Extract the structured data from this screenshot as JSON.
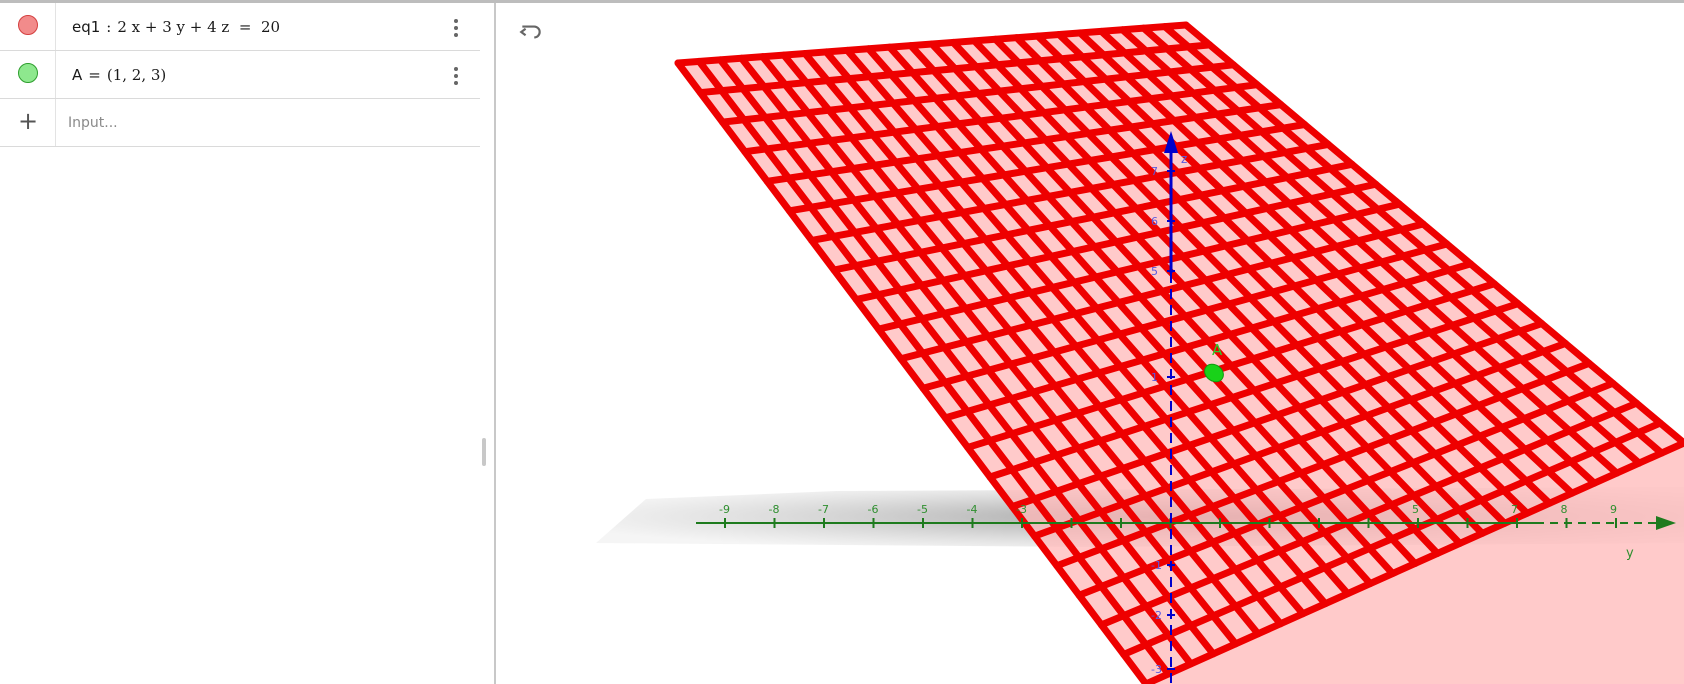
{
  "algebra": {
    "items": [
      {
        "name_part": "eq1",
        "separator": ":",
        "value_part": "2 x + 3 y + 4 z  =  20",
        "color": "#f28b8b",
        "border": "#d44040"
      },
      {
        "name_part": "A",
        "separator": "=",
        "value_part": "(1, 2, 3)",
        "color": "#8ee88e",
        "border": "#2e9e2e"
      }
    ],
    "input_placeholder": "Input...",
    "icons": {
      "menu": "more-vert-icon",
      "add": "plus-icon"
    }
  },
  "graphics": {
    "undo_icon": "undo-icon",
    "point_label": "A",
    "x_axis_ticks": [
      "-9",
      "-8",
      "-7",
      "-6",
      "-5",
      "-4",
      "-3",
      "-2",
      "-1",
      "",
      "1",
      "2",
      "3",
      "4",
      "5",
      "6",
      "7",
      "8",
      "9"
    ],
    "x_axis_visible_labels": [
      "-9",
      "-8",
      "-7",
      "-6",
      "-5",
      "-4",
      "-3",
      "5",
      "7",
      "8",
      "9"
    ],
    "z_axis_labels": [
      "7",
      "6",
      "5",
      "1",
      "-1",
      "-2",
      "-3"
    ],
    "z_axis_name": "z",
    "y_axis_name": "y",
    "colors": {
      "plane": "#ee0000",
      "plane_fill": "#ffb3b3",
      "z_axis": "#0000cc",
      "x_axis": "#1e7b1e",
      "point": "#19d219"
    }
  }
}
